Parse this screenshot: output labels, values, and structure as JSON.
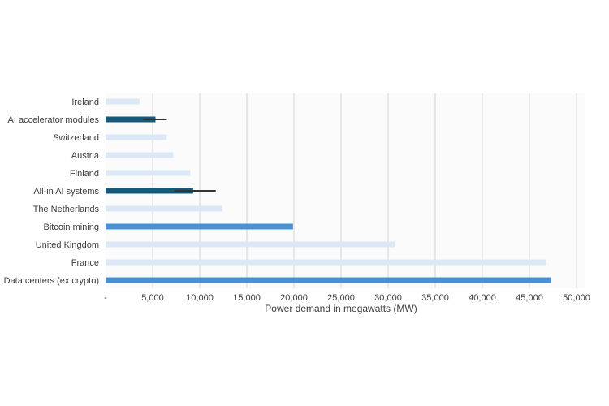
{
  "chart_data": {
    "type": "bar",
    "orientation": "horizontal",
    "xlabel": "Power demand in megawatts (MW)",
    "ylabel": "",
    "xlim": [
      0,
      50000
    ],
    "x_ticks": [
      0,
      5000,
      10000,
      15000,
      20000,
      25000,
      30000,
      35000,
      40000,
      45000,
      50000
    ],
    "x_tick_labels": [
      "-",
      "5,000",
      "10,000",
      "15,000",
      "20,000",
      "25,000",
      "30,000",
      "35,000",
      "40,000",
      "45,000",
      "50,000"
    ],
    "grid": "vertical",
    "categories": [
      "Ireland",
      "AI accelerator modules",
      "Switzerland",
      "Austria",
      "Finland",
      "All-in AI systems",
      "The Netherlands",
      "Bitcoin mining",
      "United Kingdom",
      "France",
      "Data centers (ex crypto)"
    ],
    "values": [
      3600,
      5300,
      6500,
      7200,
      9000,
      9300,
      12400,
      19900,
      30700,
      46800,
      47300
    ],
    "error_ranges": [
      null,
      [
        4000,
        6500
      ],
      null,
      null,
      null,
      [
        7300,
        11700
      ],
      null,
      null,
      null,
      null,
      null
    ],
    "bar_colors": [
      "#dce8f6",
      "#165a7b",
      "#dce8f6",
      "#dce8f6",
      "#dce8f6",
      "#165a7b",
      "#dce8f6",
      "#4a90d6",
      "#dce8f6",
      "#dce8f6",
      "#4a90d6"
    ],
    "error_bar_color": "#333333",
    "grid_color": "#d6d6d6",
    "plot_background": "#fbfbfb"
  }
}
